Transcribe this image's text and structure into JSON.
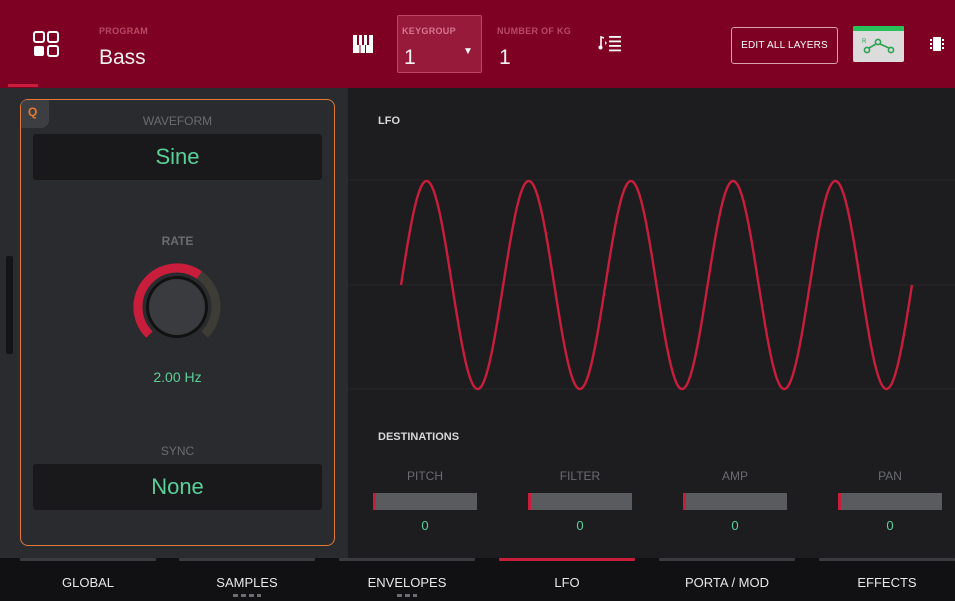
{
  "header": {
    "program_label": "PROGRAM",
    "program_value": "Bass",
    "keygroup_label": "KEYGROUP",
    "keygroup_value": "1",
    "num_kg_label": "NUMBER OF KG",
    "num_kg_value": "1",
    "edit_all_layers": "EDIT ALL LAYERS",
    "routing_icon_text": "R"
  },
  "left_panel": {
    "q_badge": "Q",
    "waveform_label": "WAVEFORM",
    "waveform_value": "Sine",
    "rate_label": "RATE",
    "rate_value": "2.00 Hz",
    "rate_knob_level": 0.63,
    "sync_label": "SYNC",
    "sync_value": "None"
  },
  "lfo": {
    "title": "LFO",
    "waveform": "sine",
    "cycles_visible": 5
  },
  "destinations": {
    "title": "DESTINATIONS",
    "items": [
      {
        "label": "PITCH",
        "value": "0"
      },
      {
        "label": "FILTER",
        "value": "0"
      },
      {
        "label": "AMP",
        "value": "0"
      },
      {
        "label": "PAN",
        "value": "0"
      }
    ]
  },
  "tabs": [
    {
      "label": "GLOBAL",
      "active": false
    },
    {
      "label": "SAMPLES",
      "active": false
    },
    {
      "label": "ENVELOPES",
      "active": false
    },
    {
      "label": "LFO",
      "active": true
    },
    {
      "label": "PORTA / MOD",
      "active": false
    },
    {
      "label": "EFFECTS",
      "active": false
    }
  ],
  "colors": {
    "header_bg": "#7e0022",
    "accent_red": "#c81e3c",
    "value_green": "#5bcf98",
    "q_orange": "#e0793a",
    "routing_green": "#29c25a"
  },
  "icons": [
    "program-grid-icon",
    "keyboard-icon",
    "keygroup-dropdown-icon",
    "note-list-icon",
    "routing-icon",
    "chip-icon",
    "rate-knob"
  ]
}
